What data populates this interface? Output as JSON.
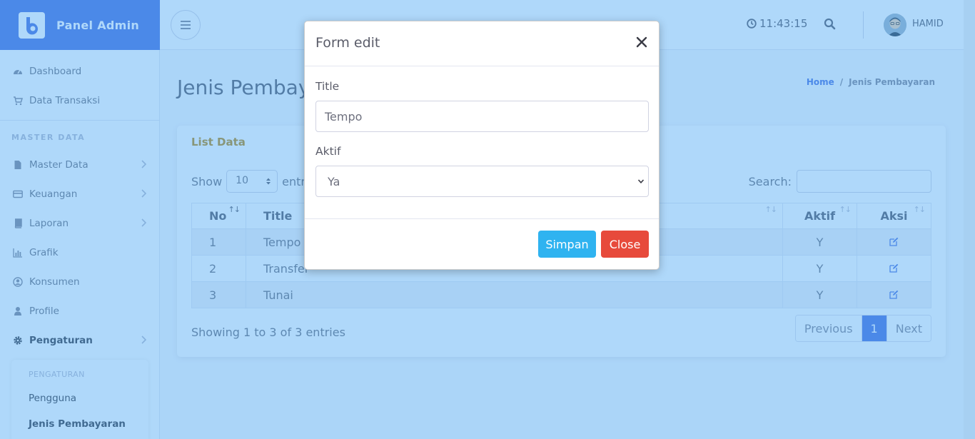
{
  "brand": {
    "name": "Panel Admin"
  },
  "topbar": {
    "time": "11:43:15",
    "username": "HAMID"
  },
  "sidebar": {
    "items": [
      {
        "label": "Dashboard"
      },
      {
        "label": "Data Transaksi"
      },
      {
        "label": "Master Data"
      },
      {
        "label": "Keuangan"
      },
      {
        "label": "Laporan"
      },
      {
        "label": "Grafik"
      },
      {
        "label": "Konsumen"
      },
      {
        "label": "Profile"
      },
      {
        "label": "Pengaturan"
      }
    ],
    "heading": "MASTER DATA",
    "submenu": {
      "heading": "PENGATURAN",
      "items": [
        {
          "label": "Pengguna"
        },
        {
          "label": "Jenis Pembayaran"
        }
      ]
    }
  },
  "page": {
    "title": "Jenis Pembayaran",
    "breadcrumb": {
      "home": "Home",
      "sep": "/",
      "current": "Jenis Pembayaran"
    }
  },
  "card": {
    "title": "List Data",
    "show_label": "Show",
    "length_value": "10",
    "entries_label": "entries",
    "search_label": "Search:",
    "columns": [
      "No",
      "Title",
      "Aktif",
      "Aksi"
    ],
    "sort_glyph": "↑↓",
    "rows": [
      {
        "no": "1",
        "title": "Tempo",
        "aktif": "Y"
      },
      {
        "no": "2",
        "title": "Transfer",
        "aktif": "Y"
      },
      {
        "no": "3",
        "title": "Tunai",
        "aktif": "Y"
      }
    ],
    "info": "Showing 1 to 3 of 3 entries",
    "pager": {
      "previous": "Previous",
      "current": "1",
      "next": "Next"
    }
  },
  "modal": {
    "title": "Form edit",
    "close_glyph": "×",
    "title_label": "Title",
    "title_value": "Tempo",
    "aktif_label": "Aktif",
    "aktif_value": "Ya",
    "save_label": "Simpan",
    "close_label": "Close"
  },
  "colors": {
    "primary": "#4e73df",
    "overlay": "#48a7f3",
    "save": "#2fb3f0",
    "danger": "#e74a3b",
    "card_title": "#b98a1a"
  },
  "icons": {
    "brand": "brand-logo-icon",
    "menu": "hamburger-icon",
    "clock": "clock-icon",
    "search": "search-icon",
    "edit": "edit-icon",
    "close": "close-icon"
  }
}
